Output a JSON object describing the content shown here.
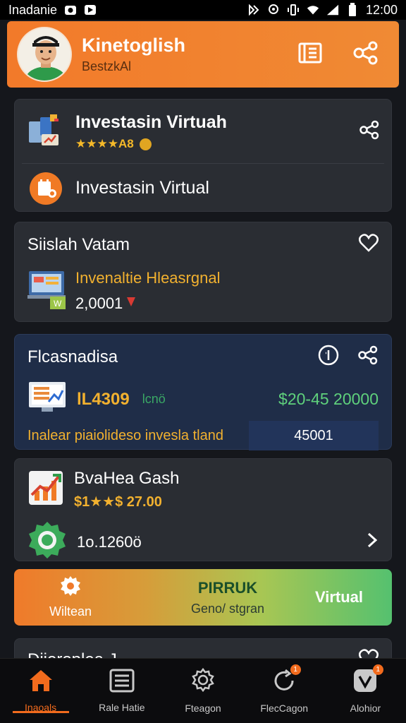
{
  "statusbar": {
    "carrier": "Inadanie",
    "time": "12:00"
  },
  "header": {
    "title": "Kinetoglish",
    "subtitle": "BestzkAl"
  },
  "card1": {
    "item1_title": "Investasin Virtuah",
    "item1_rating": "★★★★A8",
    "item2_title": "Investasin Virtual"
  },
  "card2": {
    "title": "Siislah Vatam",
    "subtitle": "Invenaltie Hleasrgnal",
    "value": "2,0001"
  },
  "card3": {
    "title": "Flcasnadisa",
    "main_value": "lL4309",
    "small_label": "lcnö",
    "range": "$20-45 20000",
    "description": "Inalear piaiolideso invesla tland",
    "input_value": "45001"
  },
  "card4": {
    "title": "BvaHea Gash",
    "price": "$1★★$ 27.00",
    "value": "1o.1260ö"
  },
  "banner": {
    "left_label": "Wiltean",
    "center_title": "PIRRUK",
    "center_sub": "Geno/ stgran",
    "right_label": "Virtual"
  },
  "partial_card": {
    "title": "Diieroplea J"
  },
  "nav": {
    "items": [
      {
        "label": "Inaoals"
      },
      {
        "label": "Rale Hatie"
      },
      {
        "label": "Fteagon"
      },
      {
        "label": "FlecCagon"
      },
      {
        "label": "Alohior"
      }
    ],
    "badge_3": "1",
    "badge_4": "1"
  },
  "colors": {
    "accent": "#f27a2a",
    "gold": "#f5b929",
    "green": "#55c16f",
    "card": "#2a2d33",
    "blue_card": "#1f2d48"
  }
}
